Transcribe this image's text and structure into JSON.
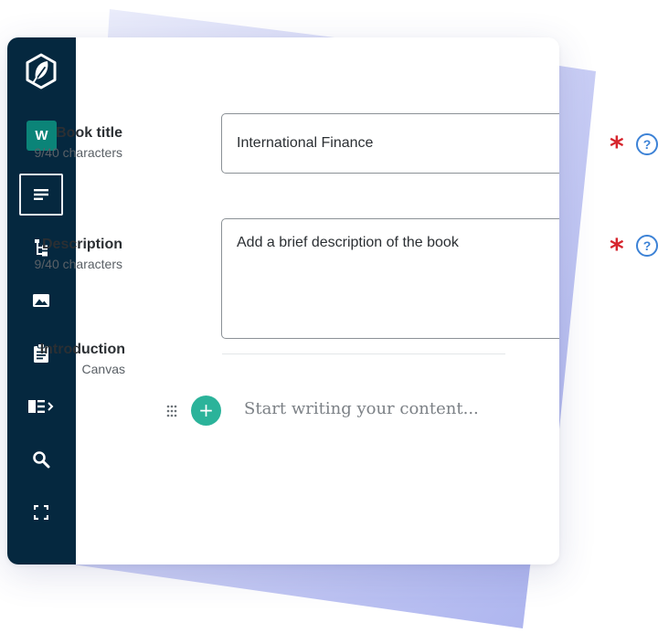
{
  "sidebar": {
    "workspace_badge": "W",
    "items": [
      {
        "name": "text-editor",
        "active": true
      },
      {
        "name": "structure-tree",
        "active": false
      },
      {
        "name": "images",
        "active": false
      },
      {
        "name": "clipboard",
        "active": false
      },
      {
        "name": "panel-toggle",
        "active": false
      },
      {
        "name": "search",
        "active": false
      },
      {
        "name": "fullscreen",
        "active": false
      }
    ]
  },
  "form": {
    "book_title": {
      "label": "Book title",
      "hint": "9/40 characters",
      "value": "International Finance",
      "required": "*",
      "help": "?"
    },
    "description": {
      "label": "Description",
      "hint": "9/40 characters",
      "placeholder": "Add a brief description of the book",
      "required": "*",
      "help": "?"
    },
    "introduction": {
      "label": "Introduction",
      "hint": "Canvas"
    }
  },
  "editor": {
    "add_label": "+",
    "placeholder": "Start writing your content..."
  },
  "colors": {
    "sidebar": "#05283f",
    "accent": "#2bb39a",
    "badge": "#0b8478",
    "required": "#d6252d",
    "help": "#3c82d6",
    "backdrop": "#b3b8f0"
  }
}
